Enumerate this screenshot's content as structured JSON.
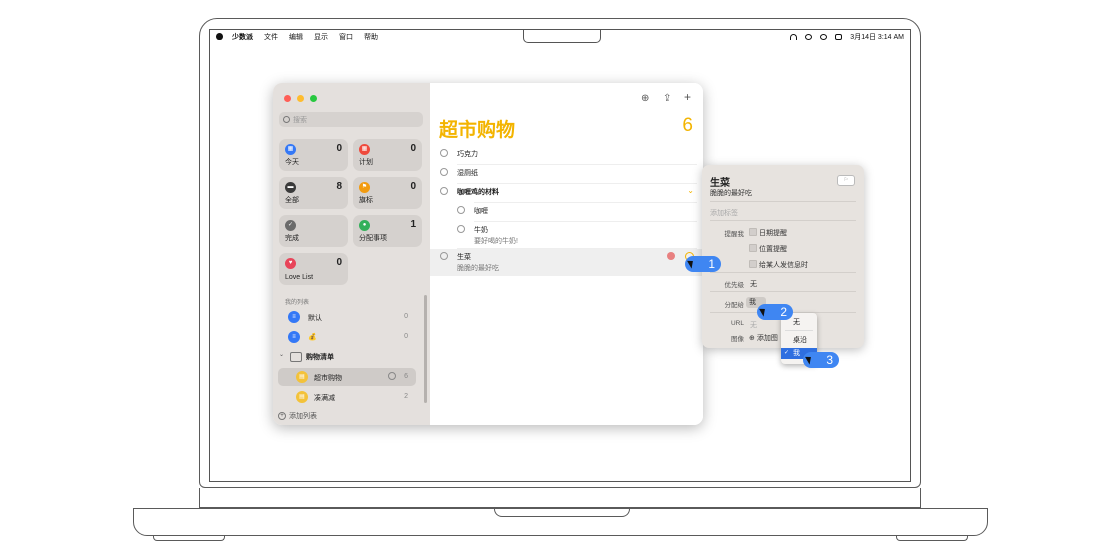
{
  "menubar": {
    "items": [
      "少数派",
      "文件",
      "编辑",
      "显示",
      "窗口",
      "帮助"
    ],
    "datetime": "3月14日  3:14 AM"
  },
  "colors": {
    "accent": "#f3b400",
    "blue": "#3478f6",
    "close": "#ff5f57",
    "min": "#febc2e",
    "max": "#28c840"
  },
  "sidebar": {
    "search_placeholder": "搜索",
    "smart_lists": [
      {
        "label": "今天",
        "count": "0",
        "icon": "calendar-today-icon",
        "color": "#3478f6"
      },
      {
        "label": "计划",
        "count": "0",
        "icon": "calendar-scheduled-icon",
        "color": "#ef4a3c"
      },
      {
        "label": "全部",
        "count": "8",
        "icon": "tray-icon",
        "color": "#3a3a3a"
      },
      {
        "label": "旗标",
        "count": "0",
        "icon": "flag-icon",
        "color": "#f29b10"
      },
      {
        "label": "完成",
        "count": "",
        "icon": "checkmark-icon",
        "color": "#6b6b6b"
      },
      {
        "label": "分配事项",
        "count": "1",
        "icon": "person-icon",
        "color": "#34b05a"
      },
      {
        "label": "Love List",
        "count": "0",
        "icon": "heart-icon",
        "color": "#e8455a"
      }
    ],
    "my_lists_label": "我的列表",
    "lists": [
      {
        "label": "默认",
        "count": "0"
      },
      {
        "label": "💰",
        "count": "0"
      }
    ],
    "group_label": "购物清单",
    "group_lists": [
      {
        "label": "超市购物",
        "count": "6"
      },
      {
        "label": "凑满减",
        "count": "2"
      }
    ],
    "add_list": "添加列表"
  },
  "main": {
    "title": "超市购物",
    "count": "6",
    "reminders": [
      {
        "name": "巧克力"
      },
      {
        "name": "湿厕纸"
      },
      {
        "name": "咖喱鸡的材料"
      },
      {
        "name": "咖喱"
      },
      {
        "name": "牛奶",
        "note": "要好喝的牛奶!"
      },
      {
        "name": "生菜",
        "note": "脆脆的最好吃"
      }
    ]
  },
  "info": {
    "title": "生菜",
    "note": "脆脆的最好吃",
    "add_tag": "添加标签",
    "remind_label": "提醒我",
    "remind_options": [
      "日期提醒",
      "位置提醒",
      "给某人发信息时"
    ],
    "priority_label": "优先级",
    "priority_value": "无",
    "assign_label": "分配给",
    "assign_value": "我",
    "url_label": "URL",
    "url_value": "无",
    "image_label": "图像",
    "image_value": "添加图"
  },
  "assign_menu": [
    "无",
    "桌沿",
    "我"
  ],
  "callouts": [
    "1",
    "2",
    "3"
  ]
}
